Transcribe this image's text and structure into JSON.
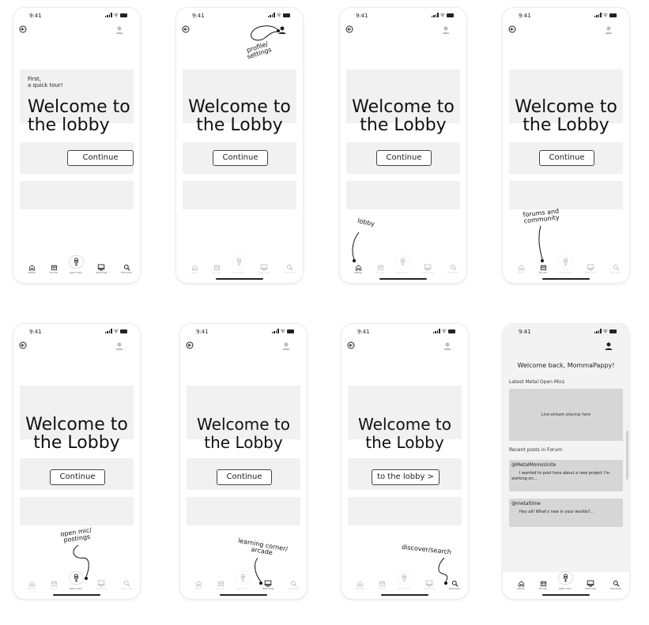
{
  "status": {
    "time": "9:41"
  },
  "tabs": [
    {
      "key": "lobby",
      "label": "lobby",
      "icon": "home-icon"
    },
    {
      "key": "forum",
      "label": "forum",
      "icon": "forum-icon"
    },
    {
      "key": "openmic",
      "label": "open mic",
      "icon": "microphone-icon"
    },
    {
      "key": "learning",
      "label": "learning",
      "icon": "book-icon"
    },
    {
      "key": "discover",
      "label": "discover",
      "icon": "search-icon"
    }
  ],
  "screens": [
    {
      "intro": "First,\na quick tour!",
      "title_line1": "Welcome to",
      "title_line2": "the lobby",
      "button": "Continue",
      "annotation": ""
    },
    {
      "intro": "",
      "title_line1": "Welcome to",
      "title_line2": "the Lobby",
      "button": "Continue",
      "annotation": "profile/\nsettings"
    },
    {
      "intro": "",
      "title_line1": "Welcome to",
      "title_line2": "the Lobby",
      "button": "Continue",
      "annotation": "lobby"
    },
    {
      "intro": "",
      "title_line1": "Welcome to",
      "title_line2": "the Lobby",
      "button": "Continue",
      "annotation": "forums and\ncommunity"
    },
    {
      "intro": "",
      "title_line1": "Welcome to",
      "title_line2": "the Lobby",
      "button": "Continue",
      "annotation": "open mic/\npostings"
    },
    {
      "intro": "",
      "title_line1": "Welcome to",
      "title_line2": "the Lobby",
      "button": "Continue",
      "annotation": "learning corner/\narcade"
    },
    {
      "intro": "",
      "title_line1": "Welcome to",
      "title_line2": "the Lobby",
      "button": "to the lobby >",
      "annotation": "discover/search"
    }
  ],
  "final": {
    "welcome": "Welcome back, MommaPappy!",
    "latest_label": "Latest Metal Open Mics",
    "live_text": "Live-stream playing here",
    "recent_label": "Recent posts in Forum",
    "posts": [
      {
        "handle": "@MetalMomsUnite",
        "body": "I wanted to post here about a new project I'm working on..."
      },
      {
        "handle": "@metaltime",
        "body": "Hey all! What's new in your worlds?..."
      }
    ]
  },
  "colors": {
    "placeholder_block": "#f1f1f1",
    "final_card": "#d6d6d6",
    "ink": "#111111"
  }
}
